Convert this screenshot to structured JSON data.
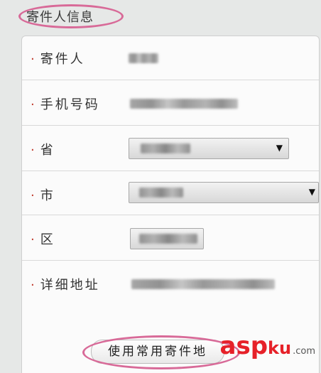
{
  "section": {
    "title": "寄件人信息"
  },
  "form": {
    "required_marker": "·",
    "rows": [
      {
        "label": "寄件人",
        "value": ""
      },
      {
        "label": "手机号码",
        "value": ""
      },
      {
        "label": "省",
        "value": ""
      },
      {
        "label": "市",
        "value": ""
      },
      {
        "label": "区",
        "value": ""
      },
      {
        "label": "详细地址",
        "value": ""
      }
    ],
    "select_caret": "▼"
  },
  "footer": {
    "button_label": "使用常用寄件地"
  },
  "watermark": {
    "asp": "asp",
    "ku": "ku",
    "com": ".com"
  },
  "colors": {
    "highlight": "#d86a98",
    "required": "#c0392b",
    "watermark": "#e62129"
  }
}
